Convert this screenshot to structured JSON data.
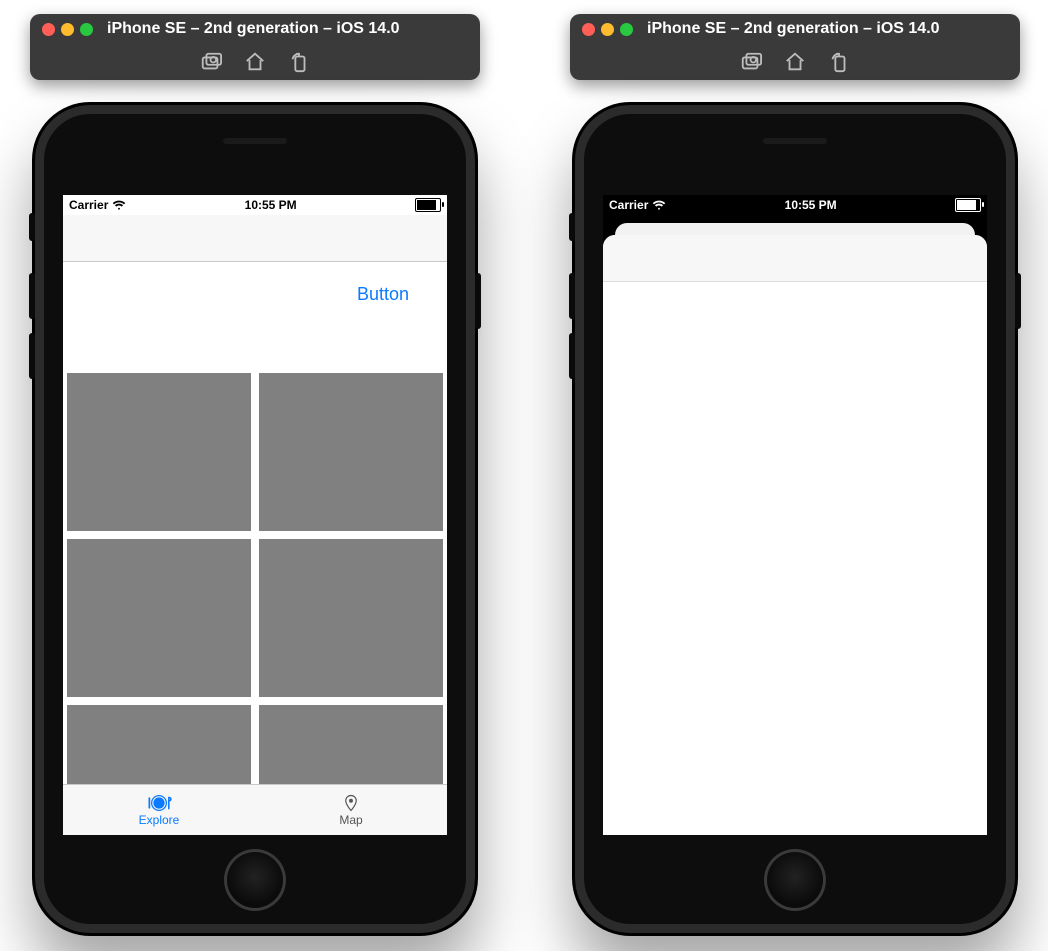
{
  "simulator": {
    "title": "iPhone SE – 2nd generation – iOS 14.0",
    "toolbar_icons": [
      "screenshot-icon",
      "home-icon",
      "rotate-icon"
    ]
  },
  "status_bar": {
    "carrier": "Carrier",
    "signal_icon": "wifi-icon",
    "time": "10:55 PM",
    "battery_icon": "battery-icon"
  },
  "left_phone": {
    "nav_bar": {
      "title": ""
    },
    "header_button_label": "Button",
    "grid_item_count": 6,
    "tabs": [
      {
        "icon": "explore-icon",
        "label": "Explore",
        "active": true
      },
      {
        "icon": "map-pin-icon",
        "label": "Map",
        "active": false
      }
    ]
  },
  "right_phone": {
    "modal_sheet": {
      "nav_bar": {
        "title": ""
      },
      "content_empty": true
    }
  }
}
